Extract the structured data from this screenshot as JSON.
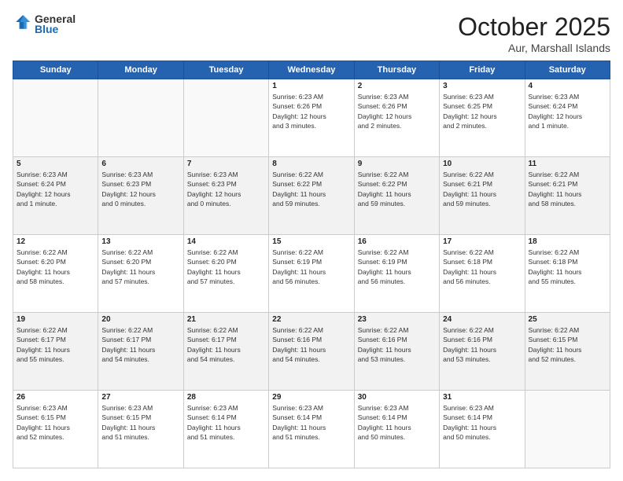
{
  "header": {
    "logo_general": "General",
    "logo_blue": "Blue",
    "month_title": "October 2025",
    "location": "Aur, Marshall Islands"
  },
  "days_of_week": [
    "Sunday",
    "Monday",
    "Tuesday",
    "Wednesday",
    "Thursday",
    "Friday",
    "Saturday"
  ],
  "weeks": [
    [
      {
        "day": "",
        "info": ""
      },
      {
        "day": "",
        "info": ""
      },
      {
        "day": "",
        "info": ""
      },
      {
        "day": "1",
        "info": "Sunrise: 6:23 AM\nSunset: 6:26 PM\nDaylight: 12 hours\nand 3 minutes."
      },
      {
        "day": "2",
        "info": "Sunrise: 6:23 AM\nSunset: 6:26 PM\nDaylight: 12 hours\nand 2 minutes."
      },
      {
        "day": "3",
        "info": "Sunrise: 6:23 AM\nSunset: 6:25 PM\nDaylight: 12 hours\nand 2 minutes."
      },
      {
        "day": "4",
        "info": "Sunrise: 6:23 AM\nSunset: 6:24 PM\nDaylight: 12 hours\nand 1 minute."
      }
    ],
    [
      {
        "day": "5",
        "info": "Sunrise: 6:23 AM\nSunset: 6:24 PM\nDaylight: 12 hours\nand 1 minute."
      },
      {
        "day": "6",
        "info": "Sunrise: 6:23 AM\nSunset: 6:23 PM\nDaylight: 12 hours\nand 0 minutes."
      },
      {
        "day": "7",
        "info": "Sunrise: 6:23 AM\nSunset: 6:23 PM\nDaylight: 12 hours\nand 0 minutes."
      },
      {
        "day": "8",
        "info": "Sunrise: 6:22 AM\nSunset: 6:22 PM\nDaylight: 11 hours\nand 59 minutes."
      },
      {
        "day": "9",
        "info": "Sunrise: 6:22 AM\nSunset: 6:22 PM\nDaylight: 11 hours\nand 59 minutes."
      },
      {
        "day": "10",
        "info": "Sunrise: 6:22 AM\nSunset: 6:21 PM\nDaylight: 11 hours\nand 59 minutes."
      },
      {
        "day": "11",
        "info": "Sunrise: 6:22 AM\nSunset: 6:21 PM\nDaylight: 11 hours\nand 58 minutes."
      }
    ],
    [
      {
        "day": "12",
        "info": "Sunrise: 6:22 AM\nSunset: 6:20 PM\nDaylight: 11 hours\nand 58 minutes."
      },
      {
        "day": "13",
        "info": "Sunrise: 6:22 AM\nSunset: 6:20 PM\nDaylight: 11 hours\nand 57 minutes."
      },
      {
        "day": "14",
        "info": "Sunrise: 6:22 AM\nSunset: 6:20 PM\nDaylight: 11 hours\nand 57 minutes."
      },
      {
        "day": "15",
        "info": "Sunrise: 6:22 AM\nSunset: 6:19 PM\nDaylight: 11 hours\nand 56 minutes."
      },
      {
        "day": "16",
        "info": "Sunrise: 6:22 AM\nSunset: 6:19 PM\nDaylight: 11 hours\nand 56 minutes."
      },
      {
        "day": "17",
        "info": "Sunrise: 6:22 AM\nSunset: 6:18 PM\nDaylight: 11 hours\nand 56 minutes."
      },
      {
        "day": "18",
        "info": "Sunrise: 6:22 AM\nSunset: 6:18 PM\nDaylight: 11 hours\nand 55 minutes."
      }
    ],
    [
      {
        "day": "19",
        "info": "Sunrise: 6:22 AM\nSunset: 6:17 PM\nDaylight: 11 hours\nand 55 minutes."
      },
      {
        "day": "20",
        "info": "Sunrise: 6:22 AM\nSunset: 6:17 PM\nDaylight: 11 hours\nand 54 minutes."
      },
      {
        "day": "21",
        "info": "Sunrise: 6:22 AM\nSunset: 6:17 PM\nDaylight: 11 hours\nand 54 minutes."
      },
      {
        "day": "22",
        "info": "Sunrise: 6:22 AM\nSunset: 6:16 PM\nDaylight: 11 hours\nand 54 minutes."
      },
      {
        "day": "23",
        "info": "Sunrise: 6:22 AM\nSunset: 6:16 PM\nDaylight: 11 hours\nand 53 minutes."
      },
      {
        "day": "24",
        "info": "Sunrise: 6:22 AM\nSunset: 6:16 PM\nDaylight: 11 hours\nand 53 minutes."
      },
      {
        "day": "25",
        "info": "Sunrise: 6:22 AM\nSunset: 6:15 PM\nDaylight: 11 hours\nand 52 minutes."
      }
    ],
    [
      {
        "day": "26",
        "info": "Sunrise: 6:23 AM\nSunset: 6:15 PM\nDaylight: 11 hours\nand 52 minutes."
      },
      {
        "day": "27",
        "info": "Sunrise: 6:23 AM\nSunset: 6:15 PM\nDaylight: 11 hours\nand 51 minutes."
      },
      {
        "day": "28",
        "info": "Sunrise: 6:23 AM\nSunset: 6:14 PM\nDaylight: 11 hours\nand 51 minutes."
      },
      {
        "day": "29",
        "info": "Sunrise: 6:23 AM\nSunset: 6:14 PM\nDaylight: 11 hours\nand 51 minutes."
      },
      {
        "day": "30",
        "info": "Sunrise: 6:23 AM\nSunset: 6:14 PM\nDaylight: 11 hours\nand 50 minutes."
      },
      {
        "day": "31",
        "info": "Sunrise: 6:23 AM\nSunset: 6:14 PM\nDaylight: 11 hours\nand 50 minutes."
      },
      {
        "day": "",
        "info": ""
      }
    ]
  ]
}
